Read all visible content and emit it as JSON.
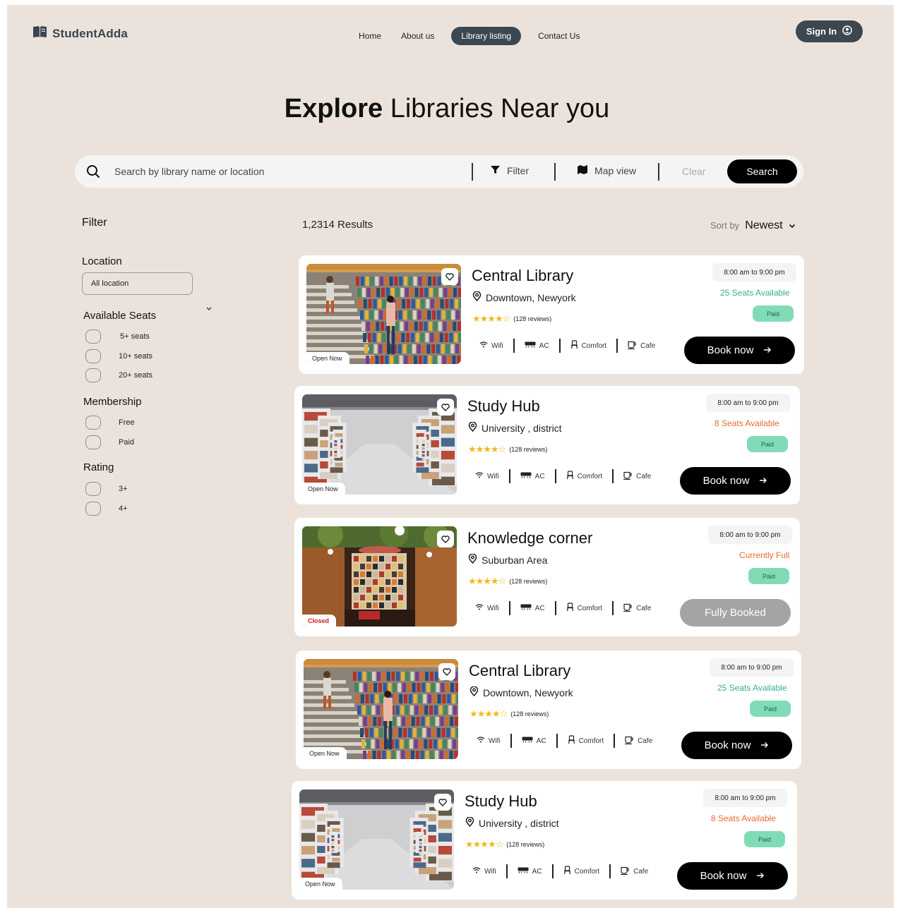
{
  "brand": {
    "name": "StudentAdda"
  },
  "nav": {
    "home": "Home",
    "about": "About us",
    "library": "Library listing",
    "contact": "Contact Us"
  },
  "signin": {
    "label": "Sign In"
  },
  "hero": {
    "title_bold": "Explore",
    "title_rest": "Libraries Near you"
  },
  "search": {
    "placeholder": "Search by library name or location",
    "filter": "Filter",
    "map": "Map view",
    "clear": "Clear",
    "button": "Search"
  },
  "filter": {
    "title": "Filter",
    "location_title": "Location",
    "location_value": "All location",
    "seats_title": "Available Seats",
    "seats": [
      "5+ seats",
      "10+ seats",
      "20+ seats"
    ],
    "membership_title": "Membership",
    "membership": [
      "Free",
      "Paid"
    ],
    "rating_title": "Rating",
    "rating": [
      "3+",
      "4+"
    ]
  },
  "results": {
    "count": "1,2314 Results",
    "sort_label": "Sort by",
    "sort_value": "Newest"
  },
  "colors": {
    "accent": "#3d4750",
    "green": "#30b08f",
    "orange": "#ea6a2d",
    "paid": "#7fdcb7",
    "star": "#f1b719"
  },
  "cards": [
    {
      "title": "Central Library",
      "location": "Downtown, Newyork",
      "reviews": "(128 reviews)",
      "stars": 4,
      "status": "Open Now",
      "hours": "8:00 am to 9:00 pm",
      "seats": "25 Seats Available",
      "membership": "Paid",
      "book": "Book now",
      "amenities": [
        "Wifi",
        "AC",
        "Comfort",
        "Cafe"
      ]
    },
    {
      "title": "Study Hub",
      "location": "University , district",
      "reviews": "(128 reviews)",
      "stars": 4,
      "status": "Open Now",
      "hours": "8:00 am to 9:00 pm",
      "seats": "8 Seats Available",
      "membership": "Paid",
      "book": "Book now",
      "amenities": [
        "Wifi",
        "AC",
        "Comfort",
        "Cafe"
      ]
    },
    {
      "title": "Knowledge corner",
      "location": "Suburban  Area",
      "reviews": "(128 reviews)",
      "stars": 4,
      "status": "Closed",
      "hours": "8:00 am to 9:00 pm",
      "seats": "Currently Full",
      "membership": "Paid",
      "book": "Fully Booked",
      "amenities": [
        "Wifi",
        "AC",
        "Comfort",
        "Cafe"
      ]
    },
    {
      "title": "Central Library",
      "location": "Downtown, Newyork",
      "reviews": "(128 reviews)",
      "stars": 4,
      "status": "Open Now",
      "hours": "8:00 am to 9:00 pm",
      "seats": "25 Seats Available",
      "membership": "Paid",
      "book": "Book now",
      "amenities": [
        "Wifi",
        "AC",
        "Comfort",
        "Cafe"
      ]
    },
    {
      "title": "Study Hub",
      "location": "University , district",
      "reviews": "(128 reviews)",
      "stars": 4,
      "status": "Open Now",
      "hours": "8:00 am to 9:00 pm",
      "seats": "8 Seats Available",
      "membership": "Paid",
      "book": "Book now",
      "amenities": [
        "Wifi",
        "AC",
        "Comfort",
        "Cafe"
      ]
    }
  ]
}
